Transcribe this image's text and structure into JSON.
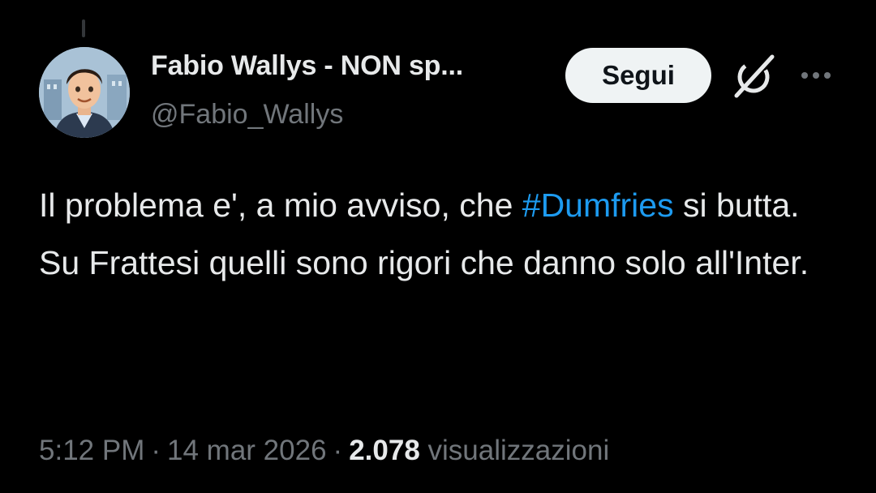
{
  "tweet": {
    "author": {
      "display_name": "Fabio Wallys - NON sp...",
      "handle": "@Fabio_Wallys"
    },
    "follow_label": "Segui",
    "text": {
      "line1_before": "Il problema e', a mio avviso, che ",
      "hashtag": "#Dumfries",
      "line1_after": " si butta.",
      "line2": "Su Frattesi quelli sono rigori che danno solo all'Inter."
    },
    "meta": {
      "time": "5:12 PM",
      "separator": "·",
      "date": "14 mar 2026",
      "views_count": "2.078",
      "views_label": "visualizzazioni"
    }
  },
  "colors": {
    "background": "#000000",
    "text_primary": "#e7e9ea",
    "text_secondary": "#71767b",
    "link": "#1d9bf0",
    "button_bg": "#eff3f4"
  },
  "icons": {
    "avatar": "cartoon-avatar",
    "grok": "grok-icon",
    "more": "more-dots-icon"
  }
}
